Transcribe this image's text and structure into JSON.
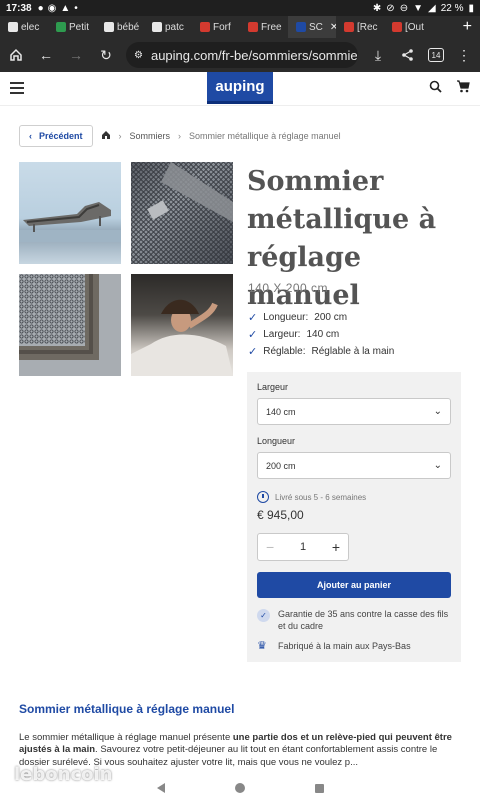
{
  "status_bar": {
    "time": "17:38",
    "battery": "22 %"
  },
  "tabs": [
    {
      "label": "elec",
      "color": "#e8e8e8",
      "active": false
    },
    {
      "label": "Petit",
      "color": "#2e9b4f",
      "active": false
    },
    {
      "label": "bébé",
      "color": "#e8e8e8",
      "active": false
    },
    {
      "label": "patc",
      "color": "#e8e8e8",
      "active": false
    },
    {
      "label": "Forf",
      "color": "#d33a2f",
      "active": false
    },
    {
      "label": "Free",
      "color": "#d33a2f",
      "active": false
    },
    {
      "label": "SC",
      "color": "#1f4aa4",
      "active": true
    },
    {
      "label": "[Rec",
      "color": "#d33a2f",
      "active": false
    },
    {
      "label": "[Out",
      "color": "#d33a2f",
      "active": false
    }
  ],
  "browser": {
    "url": "auping.com/fr-be/sommiers/sommie",
    "tab_count": "14"
  },
  "site": {
    "logo": "auping"
  },
  "breadcrumb": {
    "back": "Précédent",
    "section": "Sommiers",
    "current": "Sommier métallique à réglage manuel"
  },
  "product": {
    "title": "Sommier métallique à réglage manuel",
    "dimensions": "140 X 200 cm",
    "features": [
      {
        "label": "Longueur:",
        "value": "200 cm"
      },
      {
        "label": "Largeur:",
        "value": "140 cm"
      },
      {
        "label": "Réglable:",
        "value": "Réglable à la main"
      }
    ]
  },
  "purchase": {
    "width_label": "Largeur",
    "width_value": "140 cm",
    "length_label": "Longueur",
    "length_value": "200 cm",
    "delivery": "Livré sous 5 - 6 semaines",
    "price": "€ 945,00",
    "quantity": "1",
    "minus": "−",
    "plus": "+",
    "add_to_cart": "Ajouter au panier",
    "guarantee": "Garantie de 35 ans contre la casse des fils et du cadre",
    "made_in": "Fabriqué à la main aux Pays-Bas"
  },
  "description": {
    "title": "Sommier métallique à réglage manuel",
    "p1": "Le sommier métallique à réglage manuel présente ",
    "p1_bold": "une partie dos et un relève-pied qui peuvent être ajustés à la main",
    "p2": ". Savourez votre petit-déjeuner au lit tout en étant confortablement assis contre le dossier surélevé. Si vous souhaitez ajuster votre lit, mais que vous ne voulez p..."
  },
  "watermark": "leboncoin"
}
